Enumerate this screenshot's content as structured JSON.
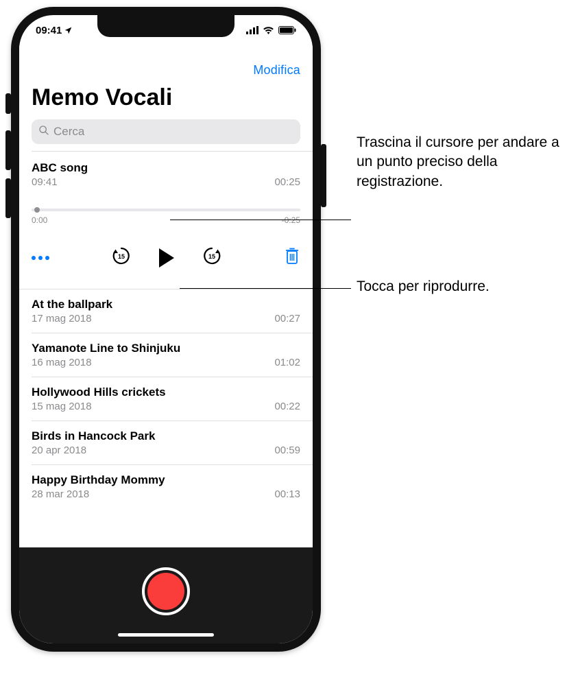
{
  "status": {
    "time": "09:41"
  },
  "topbar": {
    "edit": "Modifica"
  },
  "title": "Memo Vocali",
  "search": {
    "placeholder": "Cerca"
  },
  "selected": {
    "title": "ABC song",
    "time": "09:41",
    "duration": "00:25",
    "elapsed": "0:00",
    "remaining": "-0:25"
  },
  "recordings": [
    {
      "title": "At the ballpark",
      "date": "17 mag 2018",
      "duration": "00:27"
    },
    {
      "title": "Yamanote Line to Shinjuku",
      "date": "16 mag 2018",
      "duration": "01:02"
    },
    {
      "title": "Hollywood Hills crickets",
      "date": "15 mag 2018",
      "duration": "00:22"
    },
    {
      "title": "Birds in Hancock Park",
      "date": "20 apr 2018",
      "duration": "00:59"
    },
    {
      "title": "Happy Birthday Mommy",
      "date": "28 mar 2018",
      "duration": "00:13"
    }
  ],
  "callouts": {
    "scrub": "Trascina il cursore per andare a un punto preciso della registrazione.",
    "play": "Tocca per riprodurre."
  }
}
